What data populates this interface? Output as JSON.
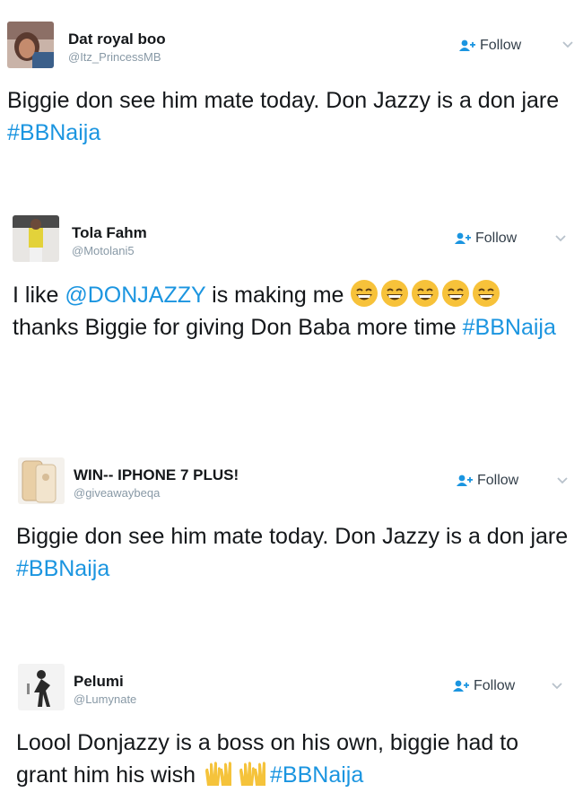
{
  "tweets": [
    {
      "name": "Dat royal boo",
      "handle": "@Itz_PrincessMB",
      "follow_label": "Follow",
      "text_before": "Biggie don see him mate today. Don Jazzy is a don jare ",
      "hashtag": "#BBNaija"
    },
    {
      "name": "Tola Fahm",
      "handle": "@Motolani5",
      "follow_label": "Follow",
      "text_prefix": "I like ",
      "mention": "@DONJAZZY",
      "text_middle": " is making me ",
      "text_after": " thanks Biggie for giving Don Baba more time ",
      "hashtag": "#BBNaija",
      "emoji": "grinning-face-with-smiling-eyes",
      "emoji_count": 5
    },
    {
      "name": "WIN-- IPHONE 7 PLUS!",
      "handle": "@giveawaybeqa",
      "follow_label": "Follow",
      "text_before": "Biggie don see him mate today. Don Jazzy is a don jare ",
      "hashtag": "#BBNaija"
    },
    {
      "name": "Pelumi",
      "handle": "@Lumynate",
      "follow_label": "Follow",
      "text_before": "Loool Donjazzy is a boss on his own, biggie had to grant him his wish ",
      "hashtag": "#BBNaija",
      "emoji": "raising-hands",
      "emoji_count": 2
    }
  ],
  "colors": {
    "hashtag": "#1b95e0",
    "handle": "#8899a6",
    "emoji_face": "#f7c23a",
    "raising_hands": "#f5c33b"
  }
}
